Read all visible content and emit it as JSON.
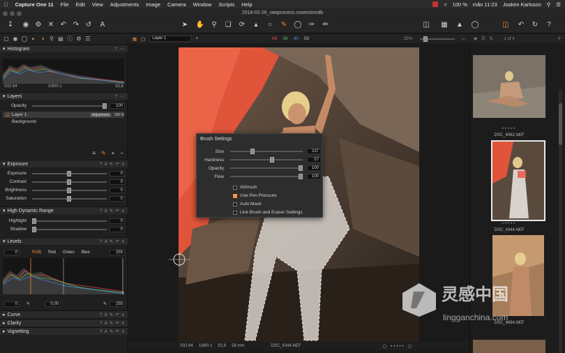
{
  "menubar": {
    "apple": "",
    "app_name": "Capture One 11",
    "items": [
      "File",
      "Edit",
      "View",
      "Adjustments",
      "Image",
      "Camera",
      "Window",
      "Scripts",
      "Help"
    ],
    "battery": "100 %",
    "time": "mån 11:23",
    "user": "Joakim Karlsson"
  },
  "toolbar": {
    "window_title": "2018-02-26_rawprocess.cosessiondb"
  },
  "histogram": {
    "title": "Histogram",
    "iso": "ISO 64",
    "shutter": "1/800 s",
    "aperture": "f/2,8"
  },
  "layers": {
    "title": "Layers",
    "opacity_label": "Opacity",
    "opacity_value": "100",
    "items": [
      {
        "name": "Layer 1",
        "badge": "Adjustment",
        "percent": "100 %"
      },
      {
        "name": "Background"
      }
    ]
  },
  "exposure": {
    "title": "Exposure",
    "rows": [
      {
        "label": "Exposure",
        "value": "0"
      },
      {
        "label": "Contrast",
        "value": "0"
      },
      {
        "label": "Brightness",
        "value": "0"
      },
      {
        "label": "Saturation",
        "value": "0"
      }
    ]
  },
  "hdr": {
    "title": "High Dynamic Range",
    "rows": [
      {
        "label": "Highlight",
        "value": "0"
      },
      {
        "label": "Shadow",
        "value": "0"
      }
    ]
  },
  "levels": {
    "title": "Levels",
    "in_low": "0",
    "in_high": "255",
    "channels": [
      "RGB",
      "Red",
      "Green",
      "Blue"
    ],
    "out_low": "0",
    "mid": "0,00",
    "out_high": "255"
  },
  "collapsed_sections": [
    "Curve",
    "Clarity",
    "Vignetting"
  ],
  "viewer": {
    "layer_select": "Layer 1",
    "rgb": {
      "r": "68",
      "g": "56",
      "b": "40",
      "a": "59"
    },
    "zoom": "25%",
    "footer": {
      "iso": "ISO 64",
      "shutter": "1/800 s",
      "aperture": "f/2,8",
      "focal": "58 mm",
      "filename": "DSC_4344.NEF"
    }
  },
  "brush_settings": {
    "title": "Brush Settings",
    "sliders": [
      {
        "label": "Size",
        "value": "237",
        "level": 0.28
      },
      {
        "label": "Hardness",
        "value": "57",
        "level": 0.57
      },
      {
        "label": "Opacity",
        "value": "100",
        "level": 1.0
      },
      {
        "label": "Flow",
        "value": "100",
        "level": 1.0
      }
    ],
    "checkboxes": [
      {
        "label": "Airbrush",
        "checked": false
      },
      {
        "label": "Use Pen Pressure",
        "checked": true
      },
      {
        "label": "Auto Mask",
        "checked": false
      },
      {
        "label": "Link Brush and Eraser Settings",
        "checked": false
      }
    ]
  },
  "filmstrip": {
    "counter": "1 of 4",
    "thumbs": [
      "DSC_4062.NEF",
      "DSC_4344.NEF",
      "DSC_4694.NEF"
    ]
  },
  "watermark": {
    "cn": "灵感中国",
    "url": "lingganchina.com"
  },
  "colors": {
    "accent": "#f08a3a",
    "panel": "#1f1f1f",
    "header": "#2a2a2a"
  }
}
